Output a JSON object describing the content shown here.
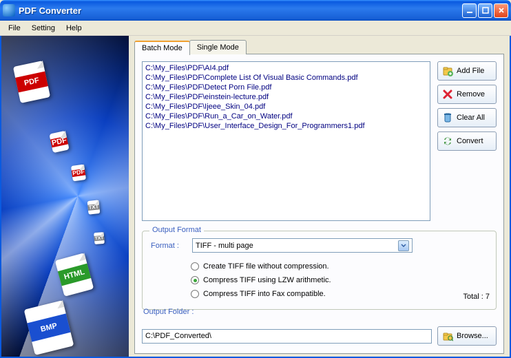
{
  "window": {
    "title": "PDF Converter"
  },
  "menu": {
    "file": "File",
    "setting": "Setting",
    "help": "Help"
  },
  "tabs": {
    "batch": "Batch Mode",
    "single": "Single Mode"
  },
  "files": [
    "C:\\My_Files\\PDF\\AI4.pdf",
    "C:\\My_Files\\PDF\\Complete List Of Visual Basic Commands.pdf",
    "C:\\My_Files\\PDF\\Detect Porn File.pdf",
    "C:\\My_Files\\PDF\\einstein-lecture.pdf",
    "C:\\My_Files\\PDF\\Ijeee_Skin_04.pdf",
    "C:\\My_Files\\PDF\\Run_a_Car_on_Water.pdf",
    "C:\\My_Files\\PDF\\User_Interface_Design_For_Programmers1.pdf"
  ],
  "buttons": {
    "add": "Add File",
    "remove": "Remove",
    "clear": "Clear All",
    "convert": "Convert",
    "browse": "Browse..."
  },
  "output_format": {
    "legend": "Output Format",
    "format_label": "Format :",
    "selected": "TIFF - multi page",
    "opt1": "Create TIFF file without compression.",
    "opt2": "Compress TIFF using LZW arithmetic.",
    "opt3": "Compress TIFF into Fax compatible."
  },
  "total_label": "Total : 7",
  "output_folder": {
    "label": "Output Folder :",
    "value": "C:\\PDF_Converted\\"
  },
  "sidebar_icons": {
    "pdf": "PDF",
    "html": "HTML",
    "bmp": "BMP",
    "txt": "TXT"
  }
}
